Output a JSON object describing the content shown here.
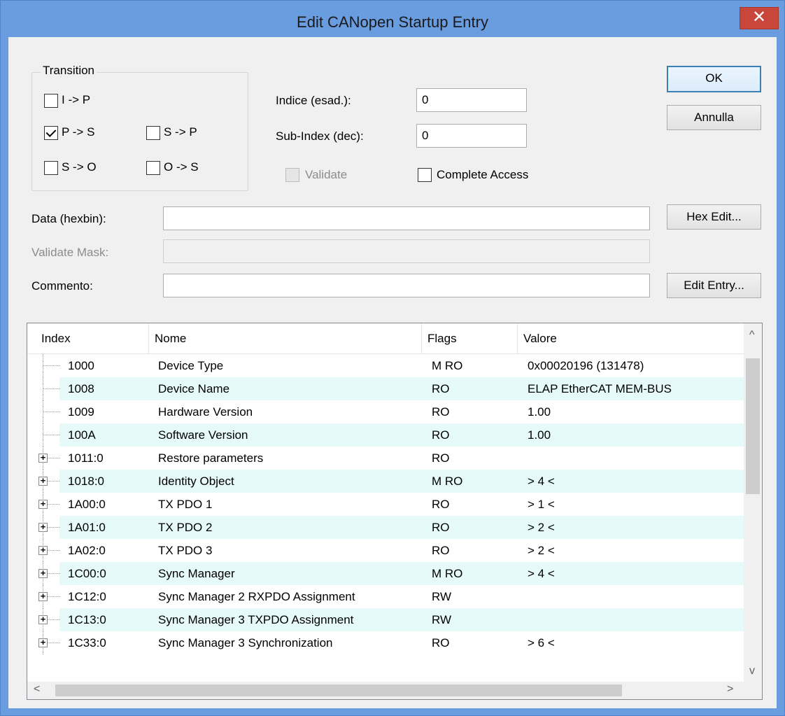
{
  "window": {
    "title": "Edit CANopen Startup Entry",
    "close_glyph": "✕"
  },
  "transition": {
    "label": "Transition",
    "options": [
      {
        "label": "I -> P",
        "checked": false
      },
      {
        "label": "P -> S",
        "checked": true
      },
      {
        "label": "S -> P",
        "checked": false
      },
      {
        "label": "S -> O",
        "checked": false
      },
      {
        "label": "O -> S",
        "checked": false
      }
    ]
  },
  "fields": {
    "index_label": "Indice (esad.):",
    "index_value": "0",
    "subindex_label": "Sub-Index (dec):",
    "subindex_value": "0",
    "validate_label": "Validate",
    "complete_access_label": "Complete Access",
    "data_label": "Data (hexbin):",
    "data_value": "",
    "validate_mask_label": "Validate Mask:",
    "validate_mask_value": "",
    "comment_label": "Commento:",
    "comment_value": ""
  },
  "buttons": {
    "ok": "OK",
    "cancel": "Annulla",
    "hex_edit": "Hex Edit...",
    "edit_entry": "Edit Entry..."
  },
  "table": {
    "columns": [
      "Index",
      "Nome",
      "Flags",
      "Valore"
    ],
    "rows": [
      {
        "index": "1000",
        "name": "Device Type",
        "flags": "M RO",
        "value": "0x00020196 (131478)",
        "expandable": false
      },
      {
        "index": "1008",
        "name": "Device Name",
        "flags": "RO",
        "value": "ELAP EtherCAT MEM-BUS",
        "expandable": false
      },
      {
        "index": "1009",
        "name": "Hardware Version",
        "flags": "RO",
        "value": "1.00",
        "expandable": false
      },
      {
        "index": "100A",
        "name": "Software Version",
        "flags": "RO",
        "value": "1.00",
        "expandable": false
      },
      {
        "index": "1011:0",
        "name": "Restore parameters",
        "flags": "RO",
        "value": "",
        "expandable": true
      },
      {
        "index": "1018:0",
        "name": "Identity Object",
        "flags": "M RO",
        "value": "> 4 <",
        "expandable": true
      },
      {
        "index": "1A00:0",
        "name": "TX PDO 1",
        "flags": "RO",
        "value": "> 1 <",
        "expandable": true
      },
      {
        "index": "1A01:0",
        "name": "TX PDO 2",
        "flags": "RO",
        "value": "> 2 <",
        "expandable": true
      },
      {
        "index": "1A02:0",
        "name": "TX PDO 3",
        "flags": "RO",
        "value": "> 2 <",
        "expandable": true
      },
      {
        "index": "1C00:0",
        "name": "Sync Manager",
        "flags": "M RO",
        "value": "> 4 <",
        "expandable": true
      },
      {
        "index": "1C12:0",
        "name": "Sync Manager 2 RXPDO Assignment",
        "flags": "RW",
        "value": "",
        "expandable": true
      },
      {
        "index": "1C13:0",
        "name": "Sync Manager 3 TXPDO Assignment",
        "flags": "RW",
        "value": "",
        "expandable": true
      },
      {
        "index": "1C33:0",
        "name": "Sync Manager 3 Synchronization",
        "flags": "RO",
        "value": "> 6 <",
        "expandable": true
      }
    ]
  },
  "icons": {
    "scroll_up": "^",
    "scroll_down": "v",
    "scroll_left": "<",
    "scroll_right": ">",
    "expand": "+"
  }
}
